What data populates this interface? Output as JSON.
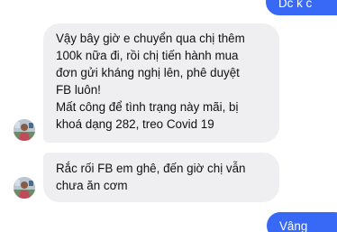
{
  "conversation": {
    "messages": [
      {
        "sender": "me",
        "lines": [
          "Dc k c"
        ]
      },
      {
        "sender": "contact",
        "lines": [
          "Vậy bây giờ e chuyển qua chị thêm",
          "100k nữa đi, rồi chị tiến hành mua",
          "đơn gửi kháng nghị lên, phê duyệt",
          "FB luôn!",
          "Mất công để tình trạng này mãi, bị",
          "khoá dạng 282, treo Covid 19"
        ]
      },
      {
        "sender": "contact",
        "lines": [
          "Rắc rối FB em ghê, đến giờ chị vẫn",
          "chưa ăn cơm"
        ]
      },
      {
        "sender": "me",
        "lines": [
          "Vâng"
        ]
      }
    ]
  },
  "colors": {
    "incoming_bubble": "#efeff2",
    "outgoing_bubble": "#3769f6",
    "incoming_text": "#111111",
    "outgoing_text": "#ffffff"
  }
}
